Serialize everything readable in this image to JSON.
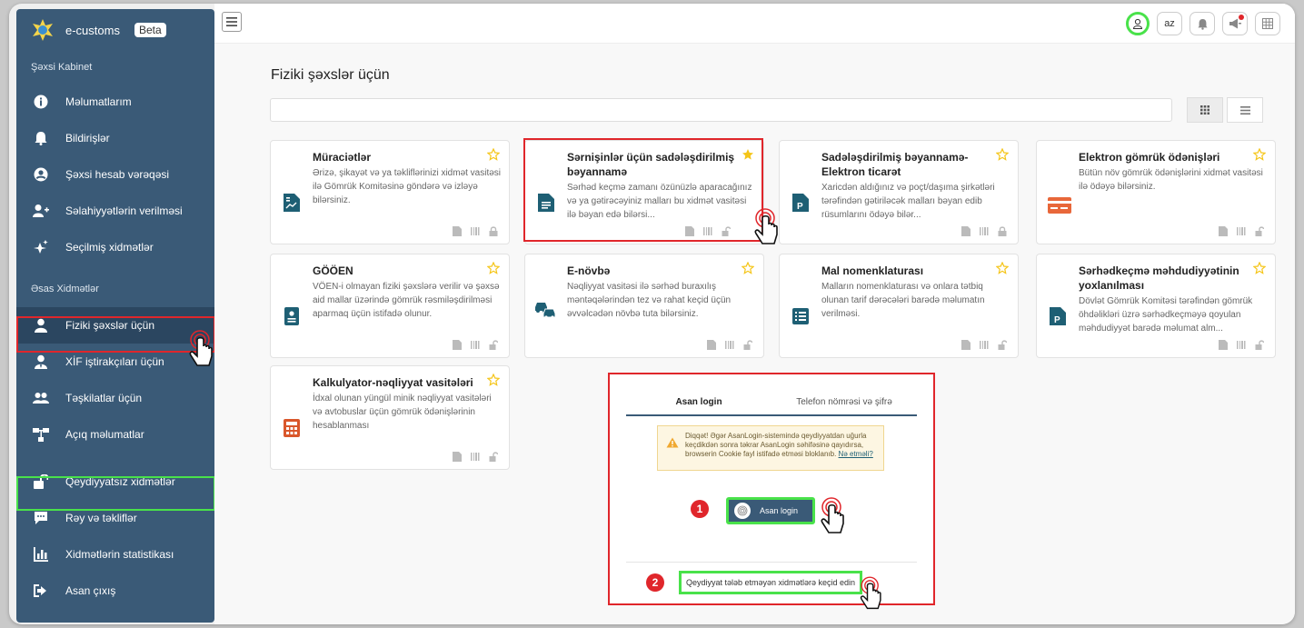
{
  "brand": {
    "name": "e-customs",
    "badge": "Beta"
  },
  "sidebar": {
    "section_personal": "Şəxsi Kabinet",
    "personal_items": [
      {
        "label": "Məlumatlarım",
        "icon": "info-icon"
      },
      {
        "label": "Bildirişlər",
        "icon": "bell-icon"
      },
      {
        "label": "Şəxsi hesab vərəqəsi",
        "icon": "user-circle-icon"
      },
      {
        "label": "Səlahiyyətlərin verilməsi",
        "icon": "user-plus-icon"
      },
      {
        "label": "Seçilmiş xidmətlər",
        "icon": "stars-icon"
      }
    ],
    "section_main": "Əsas Xidmətlər",
    "main_items": [
      {
        "label": "Fiziki şəxslər üçün",
        "icon": "user-icon"
      },
      {
        "label": "XİF iştirakçıları üçün",
        "icon": "user-tie-icon"
      },
      {
        "label": "Təşkilatlar üçün",
        "icon": "users-icon"
      },
      {
        "label": "Açıq məlumatlar",
        "icon": "sitemap-icon"
      },
      {
        "label": "Qeydiyyatsız xidmətlər",
        "icon": "unlock-icon"
      },
      {
        "label": "Rəy və təkliflər",
        "icon": "comment-icon"
      },
      {
        "label": "Xidmətlərin statistikası",
        "icon": "bar-chart-icon"
      },
      {
        "label": "Asan çıxış",
        "icon": "sign-out-icon"
      }
    ]
  },
  "topbar": {
    "lang": "az"
  },
  "page": {
    "title": "Fiziki şəxslər üçün"
  },
  "cards": [
    {
      "title": "Müraciətlər",
      "desc": "Ərizə, şikayət və ya təkliflərinizi xidmət vasitəsi ilə Gömrük Komitəsinə göndərə və izləyə bilərsiniz."
    },
    {
      "title": "Sərnişinlər üçün sadələşdirilmiş bəyannamə",
      "desc": "Sərhəd keçmə zamanı özünüzlə aparacağınız və ya gətirəcəyiniz malları bu xidmət vasitəsi ilə bəyan edə bilərsi..."
    },
    {
      "title": "Sadələşdirilmiş bəyannamə-Elektron ticarət",
      "desc": "Xaricdən aldığınız və poçt/daşıma şirkətləri tərəfindən gətiriləcək malları bəyan edib rüsumlarını ödəyə bilər..."
    },
    {
      "title": "Elektron gömrük ödənişləri",
      "desc": "Bütün növ gömrük ödənişlərini xidmət vasitəsi ilə ödəyə bilərsiniz."
    },
    {
      "title": "GÖÖEN",
      "desc": "VÖEN-i olmayan fiziki şəxslərə verilir və şəxsə aid mallar üzərində gömrük rəsmiləşdirilməsi aparmaq üçün istifadə olunur."
    },
    {
      "title": "E-növbə",
      "desc": "Nəqliyyat vasitəsi ilə sərhəd buraxılış məntəqələrindən tez və rahat keçid üçün əvvəlcədən növbə tuta bilərsiniz."
    },
    {
      "title": "Mal nomenklaturası",
      "desc": "Malların nomenklaturası və onlara tətbiq olunan tarif dərəcələri barədə məlumatın verilməsi."
    },
    {
      "title": "Sərhədkeçmə məhdudiyyətinin yoxlanılması",
      "desc": "Dövlət Gömrük Komitəsi tərəfindən gömrük öhdəlikləri üzrə sərhədkeçməyə qoyulan məhdudiyyət barədə məlumat alm..."
    },
    {
      "title": "Kalkulyator-nəqliyyat vasitələri",
      "desc": "İdxal olunan yüngül minik nəqliyyat vasitələri və avtobuslar üçün gömrük ödənişlərinin hesablanması"
    }
  ],
  "login": {
    "tab_asan": "Asan login",
    "tab_phone": "Telefon nömrəsi və şifrə",
    "warning": "Diqqət! Əgər AsanLogin-sistemində qeydiyyatdan uğurla keçdikdən sonra təkrar AsanLogin səhifəsinə qayıdırsa, browserin Cookie fayl istifadə etməsi bloklanıb.",
    "warning_link": "Nə etməli?",
    "asan_button": "Asan login",
    "skip_link": "Qeydiyyat tələb etməyən xidmətlərə keçid edin",
    "step1": "1",
    "step2": "2"
  },
  "colors": {
    "sidebar": "#3a5a77",
    "accent": "#1e5f74",
    "highlight_red": "#e0262b",
    "highlight_green": "#49e24a",
    "star": "#f5c518"
  }
}
